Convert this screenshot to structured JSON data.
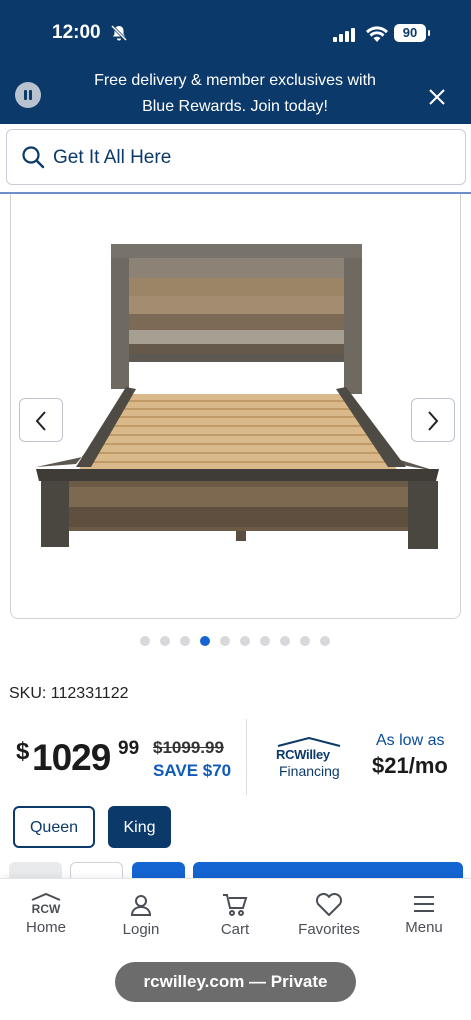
{
  "status_bar": {
    "time": "12:00",
    "battery": "90"
  },
  "promo": {
    "line1": "Free delivery & member exclusives with",
    "line2": "Blue Rewards. Join today!"
  },
  "search": {
    "placeholder": "Get It All Here"
  },
  "gallery": {
    "image": "rustic-wood-platform-bed",
    "total_images": 10,
    "active_image": 4
  },
  "product": {
    "sku": "SKU: 112331122",
    "price_whole": "1029",
    "price_cents": "99",
    "currency_symbol": "$",
    "original_price": "$1099.99",
    "savings": "SAVE $70"
  },
  "financing": {
    "brand": "RCWilley",
    "label": "Financing",
    "as_low_as": "As low as",
    "monthly": "$21/mo"
  },
  "sizes": [
    {
      "label": "Queen",
      "selected": false
    },
    {
      "label": "King",
      "selected": true
    }
  ],
  "tabbar": {
    "home_logo": "RCW",
    "home": "Home",
    "login": "Login",
    "cart": "Cart",
    "favorites": "Favorites",
    "menu": "Menu"
  },
  "browser": {
    "url": "rcwilley.com — Private"
  },
  "colors": {
    "navy": "#0b3a6a",
    "accent_blue": "#1464d1"
  }
}
